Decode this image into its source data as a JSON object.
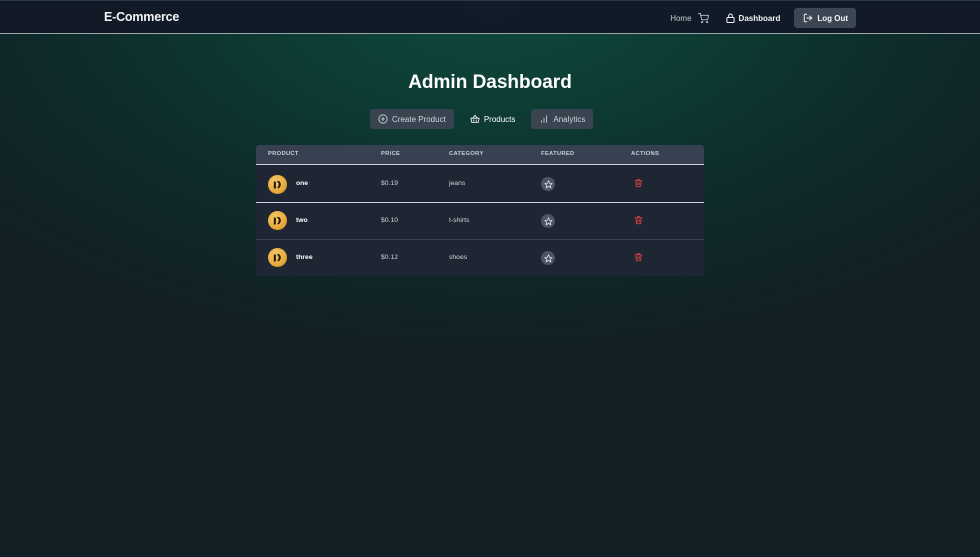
{
  "navbar": {
    "brand": "E-Commerce",
    "home_label": "Home",
    "dashboard_label": "Dashboard",
    "logout_label": "Log Out"
  },
  "page": {
    "title": "Admin Dashboard"
  },
  "tabs": [
    {
      "label": "Create Product",
      "active": false
    },
    {
      "label": "Products",
      "active": true
    },
    {
      "label": "Analytics",
      "active": false
    }
  ],
  "table": {
    "columns": [
      "PRODUCT",
      "PRICE",
      "CATEGORY",
      "FEATURED",
      "ACTIONS"
    ],
    "rows": [
      {
        "name": "one",
        "price": "$0.19",
        "category": "jeans"
      },
      {
        "name": "two",
        "price": "$0.10",
        "category": "t-shirts"
      },
      {
        "name": "three",
        "price": "$0.12",
        "category": "shoes"
      }
    ]
  },
  "colors": {
    "accent_danger": "#ef4444",
    "navbar_bg": "#111827",
    "background": "#0e4a3e"
  },
  "icons": {
    "cart": "shopping-cart-icon",
    "dashboard": "lock-icon",
    "logout": "log-out-icon",
    "create": "plus-circle-icon",
    "products": "basket-icon",
    "analytics": "bar-chart-icon",
    "featured": "star-icon",
    "delete": "trash-icon"
  }
}
